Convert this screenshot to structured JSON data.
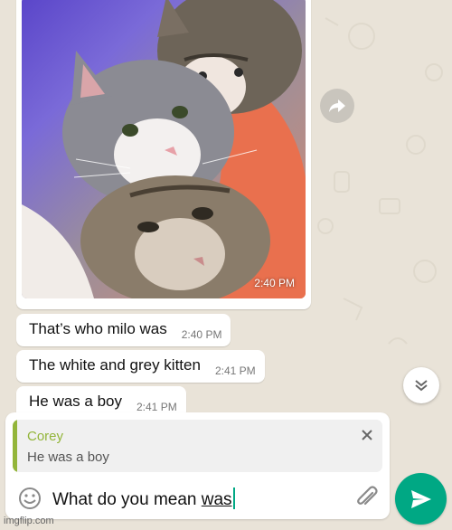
{
  "image_message": {
    "time": "2:40 PM"
  },
  "messages": [
    {
      "text": "That’s who milo was",
      "time": "2:40 PM"
    },
    {
      "text": "The white and grey kitten",
      "time": "2:41 PM"
    },
    {
      "text": "He was a boy",
      "time": "2:41 PM"
    }
  ],
  "reply": {
    "name": "Corey",
    "text": "He was a boy"
  },
  "composer": {
    "typed_text": "What do you mean ",
    "underlined_word": "was"
  },
  "watermark": "imgflip.com",
  "colors": {
    "accent": "#00a884",
    "reply_accent": "#93b53a",
    "background": "#e9e3d8"
  },
  "icons": [
    "forward-icon",
    "chevron-down-icon",
    "close-icon",
    "emoji-icon",
    "paperclip-icon",
    "send-icon"
  ]
}
